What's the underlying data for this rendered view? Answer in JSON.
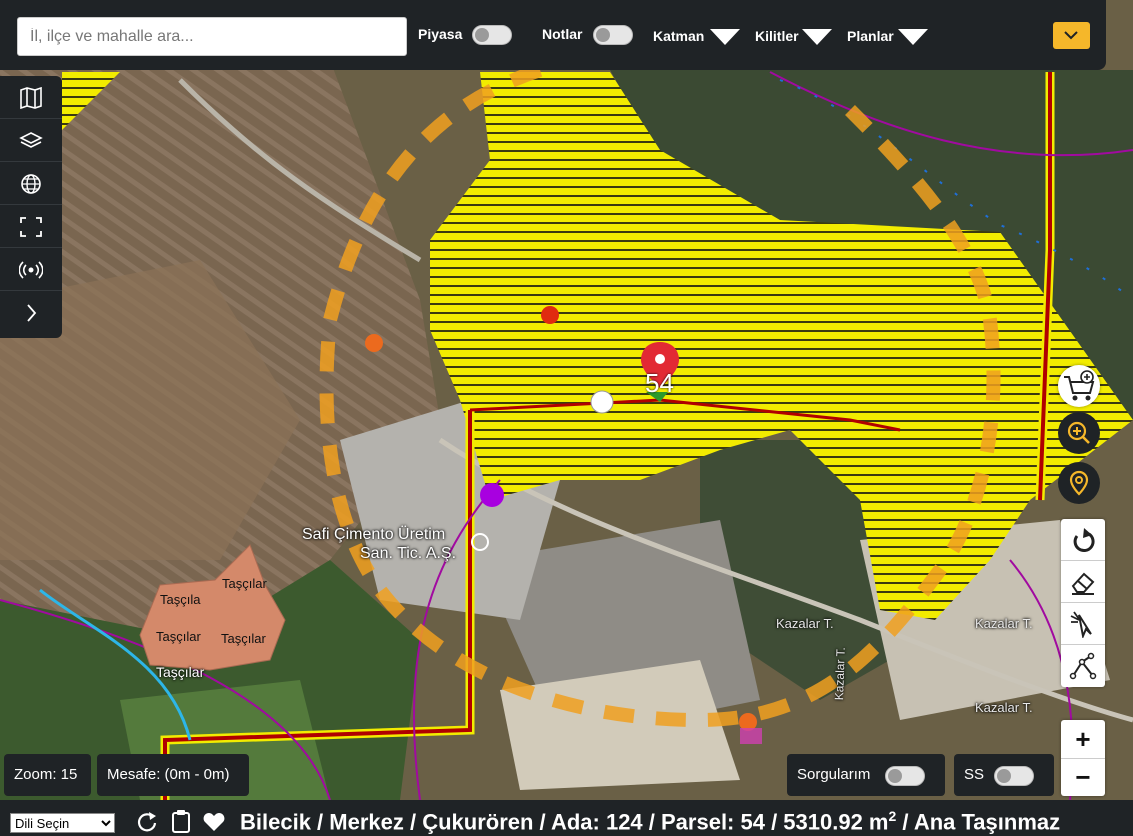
{
  "search": {
    "placeholder": "İl, ilçe ve mahalle ara..."
  },
  "toolbar": {
    "piyasa_label": "Piyasa",
    "notlar_label": "Notlar",
    "katman_label": "Katman",
    "kilitler_label": "Kilitler",
    "planlar_label": "Planlar"
  },
  "left_tools": [
    "map-icon",
    "layers-icon",
    "globe-icon",
    "fullscreen-icon",
    "broadcast-icon",
    "chevron-right-icon"
  ],
  "right_tools": [
    "cart-add-icon",
    "zoom-search-icon",
    "location-pin-icon",
    "undo-icon",
    "eraser-icon",
    "pointer-tool-icon",
    "polyline-icon"
  ],
  "map": {
    "parcel_marker_number": "54",
    "place_labels": {
      "factory_line1": "Safi Çimento Üretim",
      "factory_line2": "San. Tic. A.Ş.",
      "tascilar_1": "Taşçılar",
      "tascilar_2": "Taşçıla",
      "tascilar_3": "Taşçılar",
      "tascilar_4": "Taşçılar",
      "tascilar_5": "Taşçılar",
      "kazalar_1": "Kazalar T.",
      "kazalar_2": "Kazalar T.",
      "kazalar_3": "Kazalar T.",
      "kazalar_road": "Kazalar T."
    },
    "colors": {
      "zone_fill": "#f2ec00",
      "boundary": "#b00000",
      "route": "#f0a020",
      "accent": "#f5b72a"
    }
  },
  "zoom": {
    "text": "Zoom: 15"
  },
  "distance": {
    "text": "Mesafe: (0m - 0m)"
  },
  "sorgularim_label": "Sorgularım",
  "ss_label": "SS",
  "zoom_in": "+",
  "zoom_out": "−",
  "language_select": "Dili Seçin",
  "breadcrumb": {
    "text": "Bilecik / Merkez / Çukurören / Ada: 124 / Parsel: 54 / 5310.92 m",
    "superscript": "2",
    "suffix": " / Ana Taşınmaz"
  }
}
